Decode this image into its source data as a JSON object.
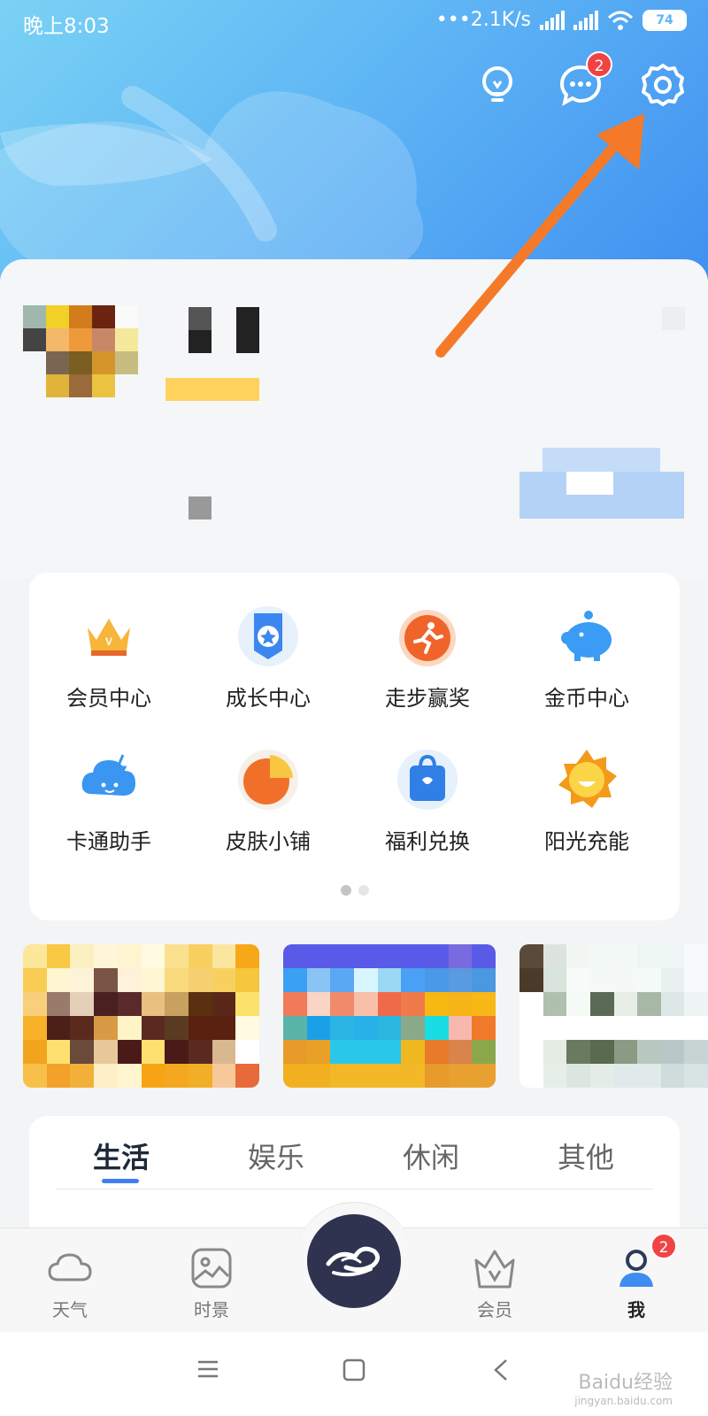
{
  "status_bar": {
    "time": "晚上8:03",
    "speed": "•••2.1K/s",
    "battery": "74"
  },
  "header": {
    "icons": [
      "lightbulb-icon",
      "message-icon",
      "settings-icon"
    ],
    "message_badge": "2"
  },
  "menu": {
    "items": [
      {
        "label": "会员中心",
        "icon": "crown-icon"
      },
      {
        "label": "成长中心",
        "icon": "medal-icon"
      },
      {
        "label": "走步赢奖",
        "icon": "running-icon"
      },
      {
        "label": "金币中心",
        "icon": "piggy-bank-icon"
      },
      {
        "label": "卡通助手",
        "icon": "cartoon-cloud-icon"
      },
      {
        "label": "皮肤小铺",
        "icon": "pie-chart-icon"
      },
      {
        "label": "福利兑换",
        "icon": "shopping-bag-icon"
      },
      {
        "label": "阳光充能",
        "icon": "sun-icon"
      }
    ],
    "page_count": 2,
    "current_page": 1
  },
  "tabs": {
    "items": [
      "生活",
      "娱乐",
      "休闲",
      "其他"
    ],
    "active": "生活"
  },
  "bottom_nav": {
    "items": [
      {
        "label": "天气",
        "icon": "cloud-icon"
      },
      {
        "label": "时景",
        "icon": "image-icon"
      },
      {
        "label": "",
        "icon": "app-logo-icon"
      },
      {
        "label": "会员",
        "icon": "vip-crown-icon"
      },
      {
        "label": "我",
        "icon": "user-icon"
      }
    ],
    "active": "我",
    "me_badge": "2"
  },
  "watermark": {
    "text": "Baidu经验",
    "sub": "jingyan.baidu.com"
  },
  "colors": {
    "accent": "#3f7ef0",
    "badge": "#f04444",
    "annotation_arrow": "#f47a2a"
  }
}
